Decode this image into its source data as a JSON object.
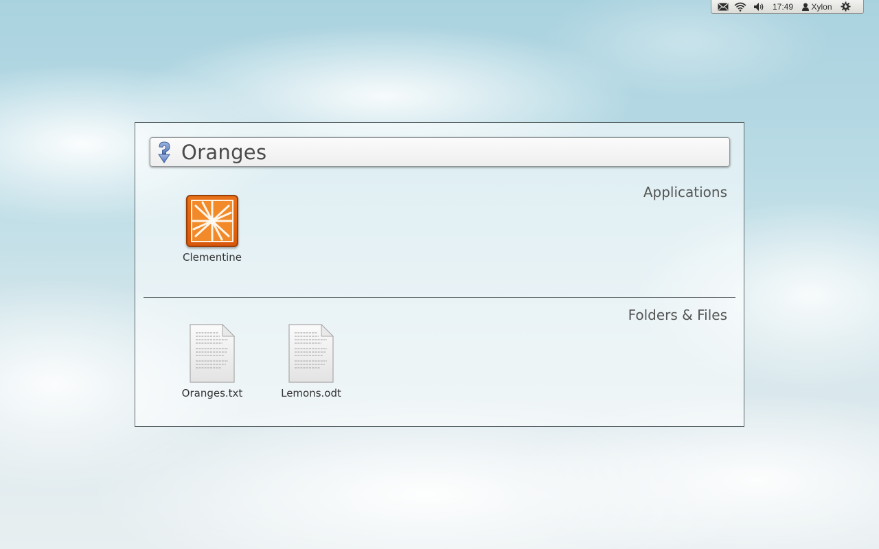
{
  "panel": {
    "mail_icon": "mail-icon",
    "wifi_icon": "wifi-icon",
    "volume_icon": "volume-icon",
    "clock": "17:49",
    "user_name": "Xylon",
    "session_icon": "gear-icon"
  },
  "dash": {
    "search": {
      "query": "Oranges",
      "icon": "search-icon"
    },
    "applications": {
      "heading": "Applications",
      "items": [
        {
          "label": "Clementine",
          "icon": "clementine-icon"
        }
      ]
    },
    "files": {
      "heading": "Folders & Files",
      "items": [
        {
          "label": "Oranges.txt",
          "icon": "text-document-icon"
        },
        {
          "label": "Lemons.odt",
          "icon": "text-document-icon"
        }
      ]
    }
  },
  "colors": {
    "app_icon_orange": "#e8721a",
    "search_icon_blue": "#6f8fc8"
  }
}
